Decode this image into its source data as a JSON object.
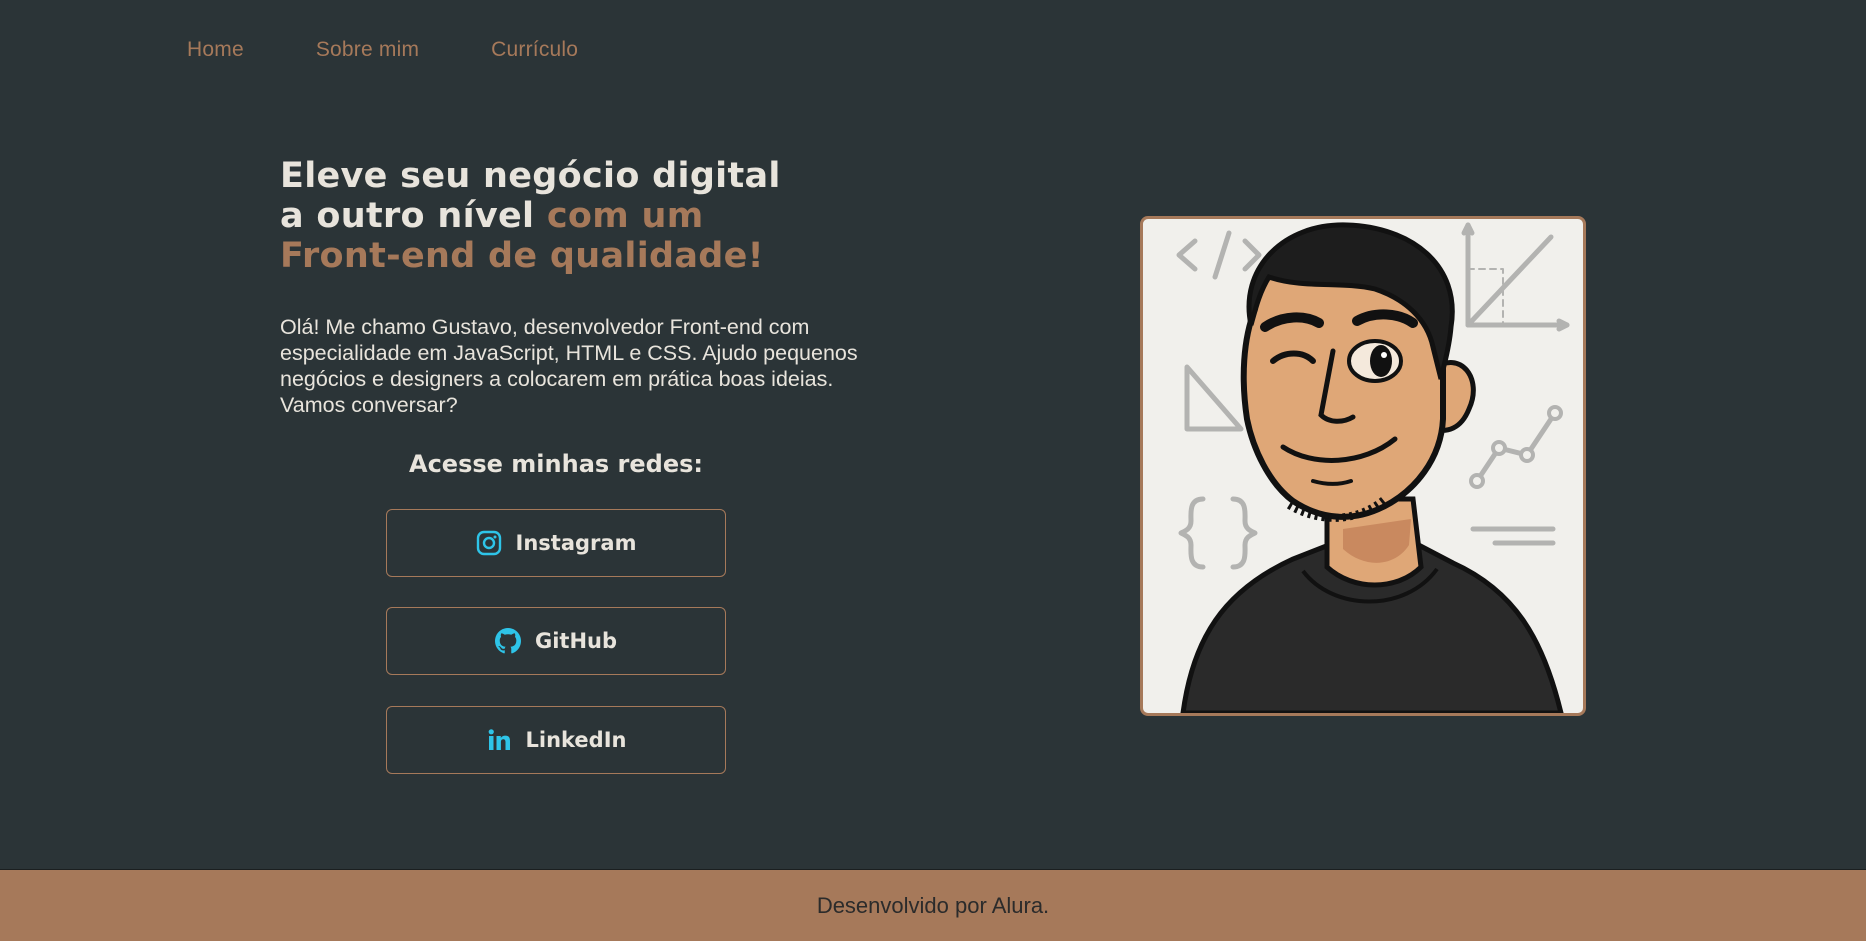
{
  "nav": {
    "items": [
      {
        "label": "Home"
      },
      {
        "label": "Sobre mim"
      },
      {
        "label": "Currículo"
      }
    ]
  },
  "hero": {
    "title_line1": "Eleve seu negócio digital",
    "title_line2_plain": "a outro nível ",
    "title_line2_accent": "com um",
    "title_line3_accent": "Front-end de qualidade!",
    "intro": "Olá! Me chamo Gustavo, desenvolvedor Front-end com especialidade em JavaScript, HTML e CSS. Ajudo pequenos negócios e designers a colocarem em prática boas ideias. Vamos conversar?"
  },
  "networks": {
    "title": "Acesse minhas redes:",
    "buttons": [
      {
        "label": "Instagram",
        "icon": "instagram-icon"
      },
      {
        "label": "GitHub",
        "icon": "github-icon"
      },
      {
        "label": "LinkedIn",
        "icon": "linkedin-icon"
      }
    ]
  },
  "portrait": {
    "icon": "avatar-illustration"
  },
  "footer": {
    "text": "Desenvolvido por Alura."
  },
  "colors": {
    "background": "#2b3437",
    "accent": "#a6795a",
    "text": "#e8e4dc",
    "icon": "#2ec4e8"
  }
}
